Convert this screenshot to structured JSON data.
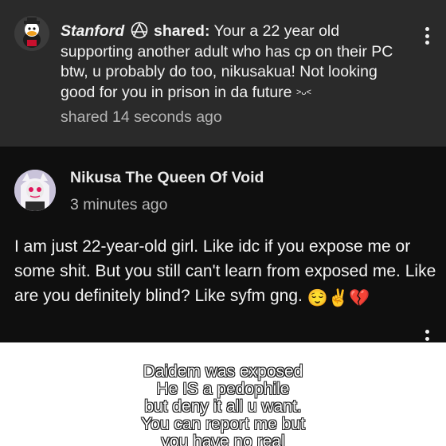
{
  "shared_post": {
    "username": "Stanford",
    "shared_label": "shared:",
    "message": "Your a 22 year old supporting another adult who has cp on their PC btw, u probably do too, nikusakua! Not looking good for you in prison in da future",
    "face": ">ᴗ<",
    "time": "shared 14 seconds ago",
    "avatar_icon": "duck-avatar-icon",
    "badge_icon": "anarchy-icon"
  },
  "comment": {
    "author": "Nikusa The Queen Of Void",
    "time": "3 minutes ago",
    "body": "I am just 22-year-old girl. Like idc if you expose me or some shit. But you still can't learn from exposed me. Like are you definitely blind? Like syfm gng.",
    "emojis": [
      "😌",
      "✌️",
      "💔"
    ]
  },
  "image_text": {
    "lines": [
      "Daidem was exposed",
      "He IS a pedophile",
      "but deny it all u want.",
      "You can report me but",
      "you have no real"
    ]
  },
  "colors": {
    "shared_bg": "#2a2a2a",
    "comment_bg": "#0f0f0f",
    "image_bg": "#ffffff"
  }
}
